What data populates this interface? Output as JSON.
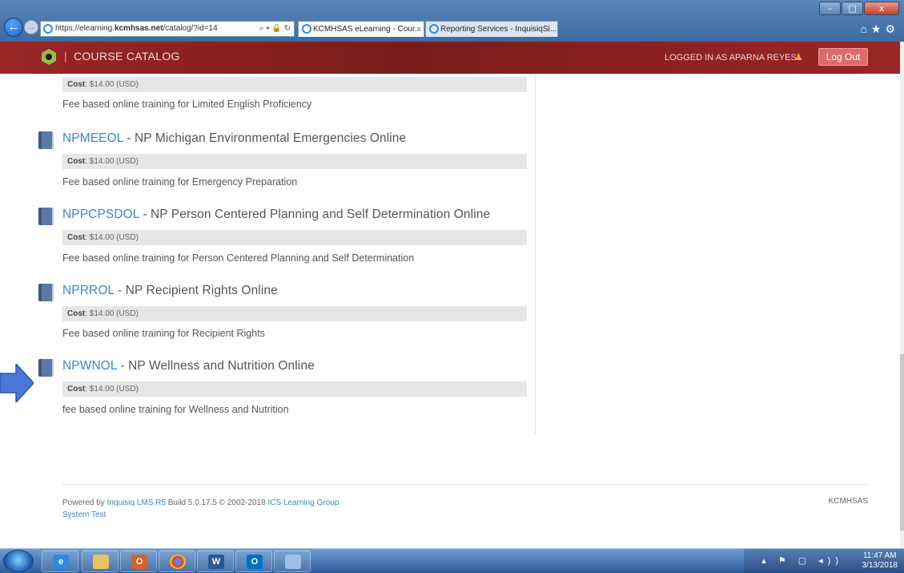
{
  "browser": {
    "url_prefix": "https://elearning.",
    "url_domain": "kcmhsas.net",
    "url_path": "/catalog/?id=14",
    "address_tools": "⌕ ▾ 🔒 ↻",
    "tabs": [
      {
        "label": "KCMHSAS eLearning - Cour...",
        "close": "×"
      },
      {
        "label": "Reporting Services - InquisiqSi..."
      }
    ],
    "window_controls": {
      "minimize": "–",
      "maximize": "□",
      "close": "x"
    }
  },
  "header": {
    "title": "COURSE CATALOG",
    "logged_in_text": "LOGGED IN AS APARNA REYES",
    "logout_label": "Log Out"
  },
  "courses": [
    {
      "code": "",
      "name": "",
      "cost_label": "Cost",
      "cost_value": ": $14.00 (USD)",
      "description": "Fee based online training for Limited English Proficiency"
    },
    {
      "code": "NPMEEOL",
      "name": " - NP Michigan Environmental Emergencies Online",
      "cost_label": "Cost",
      "cost_value": ": $14.00 (USD)",
      "description": "Fee based online training for Emergency Preparation"
    },
    {
      "code": "NPPCPSDOL",
      "name": " - NP Person Centered Planning and Self Determination Online",
      "cost_label": "Cost",
      "cost_value": ": $14.00 (USD)",
      "description": "Fee based online training for Person Centered Planning and Self Determination"
    },
    {
      "code": "NPRROL",
      "name": " - NP Recipient Rights Online",
      "cost_label": "Cost",
      "cost_value": ": $14.00 (USD)",
      "description": "Fee based online training for Recipient Rights"
    },
    {
      "code": "NPWNOL",
      "name": " - NP Wellness and Nutrition Online",
      "cost_label": "Cost",
      "cost_value": ": $14.00 (USD)",
      "description": "fee based online training for Wellness and Nutrition"
    }
  ],
  "footer": {
    "powered_by": "Powered by ",
    "lms_link": "Inquisiq LMS R5",
    "build_text": " Build 5.0.17.5 © 2002-2018 ",
    "company_link": "ICS Learning Group",
    "system_link": "System Test",
    "right_text": "KCMHSAS"
  },
  "taskbar": {
    "time": "11:47 AM",
    "date": "3/13/2018",
    "tray_icons": "▴ ⚑ ▢ ◂))"
  },
  "colors": {
    "header_bg": "#8b2020",
    "link": "#3a86c8",
    "arrow": "#4a78d6",
    "logout_bg": "#e06a6a"
  }
}
